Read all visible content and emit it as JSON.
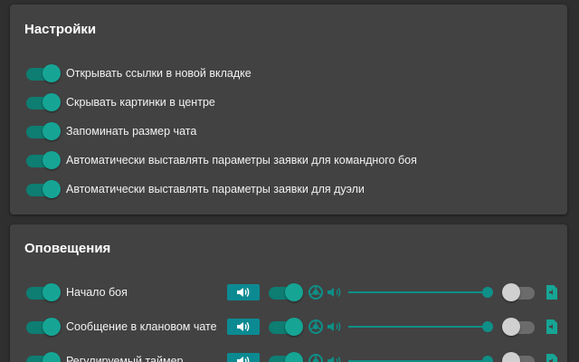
{
  "settings": {
    "title": "Настройки",
    "items": [
      {
        "label": "Открывать ссылки в новой вкладке",
        "on": true
      },
      {
        "label": "Скрывать картинки в центре",
        "on": true
      },
      {
        "label": "Запоминать размер чата",
        "on": true
      },
      {
        "label": "Автоматически выставлять параметры заявки для командного боя",
        "on": true
      },
      {
        "label": "Автоматически выставлять параметры заявки для дуэли",
        "on": true
      }
    ]
  },
  "notifications": {
    "title": "Оповещения",
    "items": [
      {
        "label": "Начало боя",
        "on": true,
        "browser_on": true,
        "volume": 1.0,
        "custom_sound_on": false
      },
      {
        "label": "Сообщение в клановом чате",
        "on": true,
        "browser_on": true,
        "volume": 1.0,
        "custom_sound_on": false
      },
      {
        "label": "Регулируемый таймер",
        "on": true,
        "browser_on": true,
        "volume": 1.0,
        "custom_sound_on": false
      }
    ]
  },
  "icons": {
    "sound_button": "volume-icon",
    "browser": "chrome-icon",
    "volume": "volume-icon",
    "file": "audio-file-icon"
  },
  "colors": {
    "background": "#2f2f2f",
    "panel": "#424242",
    "accent": "#16a595",
    "accent_dark": "#0e7d72",
    "button": "#0c8a92"
  }
}
